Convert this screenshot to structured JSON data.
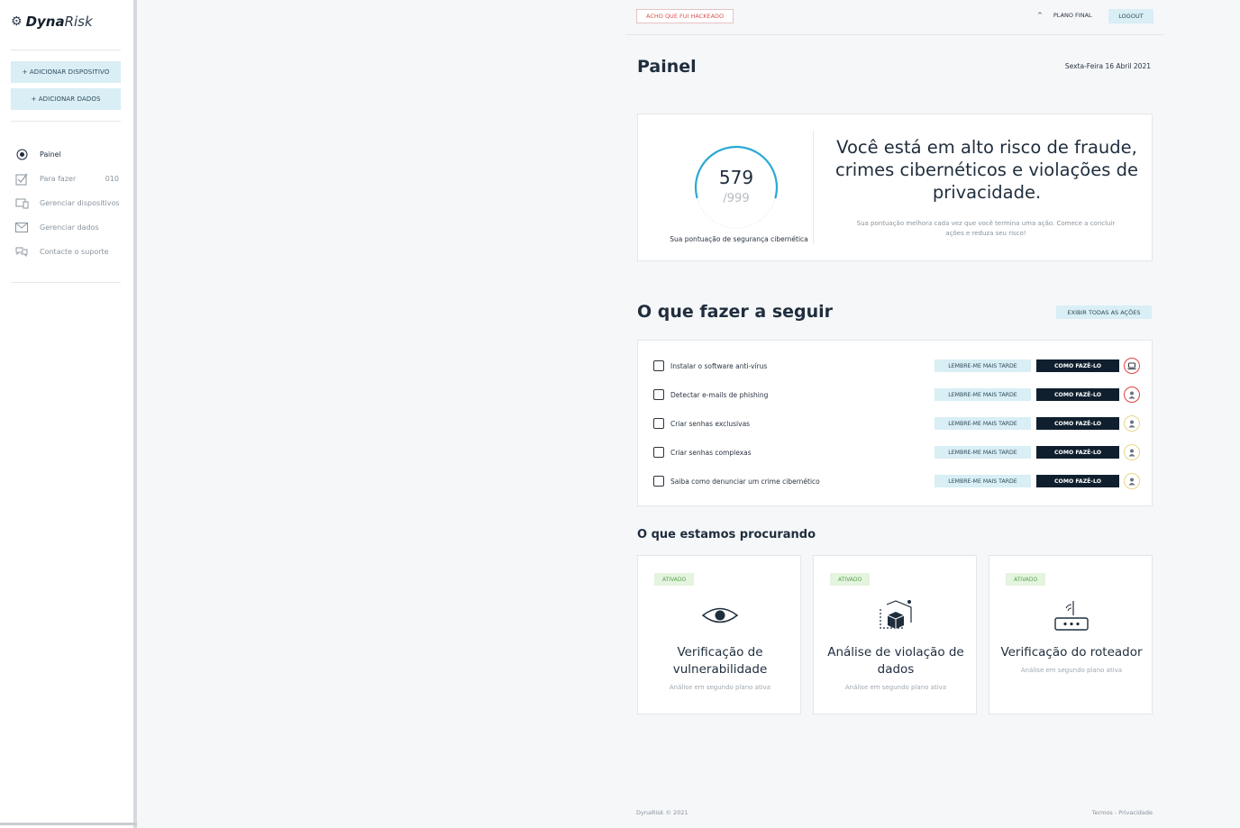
{
  "sidebar": {
    "logo_bold": "Dyna",
    "logo_rest": "Risk",
    "add_device": "+ ADICIONAR DISPOSITIVO",
    "add_data": "+ ADICIONAR DADOS",
    "items": [
      {
        "label": "Painel",
        "icon": "radio-dot-icon",
        "count": ""
      },
      {
        "label": "Para fazer",
        "icon": "checklist-icon",
        "count": "010"
      },
      {
        "label": "Gerenciar dispositivos",
        "icon": "devices-icon",
        "count": ""
      },
      {
        "label": "Gerenciar dados",
        "icon": "mail-icon",
        "count": ""
      },
      {
        "label": "Contacte o suporte",
        "icon": "chat-icon",
        "count": ""
      }
    ]
  },
  "topbar": {
    "hacked_button": "ACHO QUE FUI HACKEADO",
    "plan": "PLANO FINAL",
    "logout": "LOGOUT"
  },
  "header": {
    "title": "Painel",
    "date": "Sexta-Feira 16 Abril 2021"
  },
  "score": {
    "value": "579",
    "max": "/999",
    "fraction": 0.5796,
    "caption": "Sua pontuação de segurança cibernética",
    "risk_title": "Você está em alto risco de fraude, crimes cibernéticos e violações de privacidade.",
    "risk_sub": "Sua pontuação melhora cada vez que você termina uma ação. Comece a concluir ações e reduza seu risco!",
    "accent_color": "#29a9d6"
  },
  "next_actions": {
    "title": "O que fazer a seguir",
    "show_all": "EXIBIR TODAS AS AÇÕES",
    "later_label": "LEMBRE-ME MAIS TARDE",
    "howto_label": "COMO FAZÊ-LO",
    "items": [
      {
        "label": "Instalar o software anti-vírus",
        "badge": "laptop-icon",
        "badge_color": "#e0453f"
      },
      {
        "label": "Detectar e-mails de phishing",
        "badge": "user-icon",
        "badge_color": "#e0453f"
      },
      {
        "label": "Criar senhas exclusivas",
        "badge": "user-icon",
        "badge_color": "#e8d58a"
      },
      {
        "label": "Criar senhas complexas",
        "badge": "user-icon",
        "badge_color": "#e8d58a"
      },
      {
        "label": "Saiba como denunciar um crime cibernético",
        "badge": "user-icon",
        "badge_color": "#e8d58a"
      }
    ]
  },
  "looking_for": {
    "title": "O que estamos procurando",
    "cards": [
      {
        "badge": "ATIVADO",
        "icon": "eye-icon",
        "title": "Verificação de vulnerabilidade",
        "sub": "Análise em segundo plano ativa"
      },
      {
        "badge": "ATIVADO",
        "icon": "cube-scan-icon",
        "title": "Análise de violação de dados",
        "sub": "Análise em segundo plano ativa"
      },
      {
        "badge": "ATIVADO",
        "icon": "router-icon",
        "title": "Verificação do roteador",
        "sub": "Análise em segundo plano ativa"
      }
    ]
  },
  "footer": {
    "copyright": "DynaRisk © 2021",
    "links": "Termos - Privacidade"
  }
}
